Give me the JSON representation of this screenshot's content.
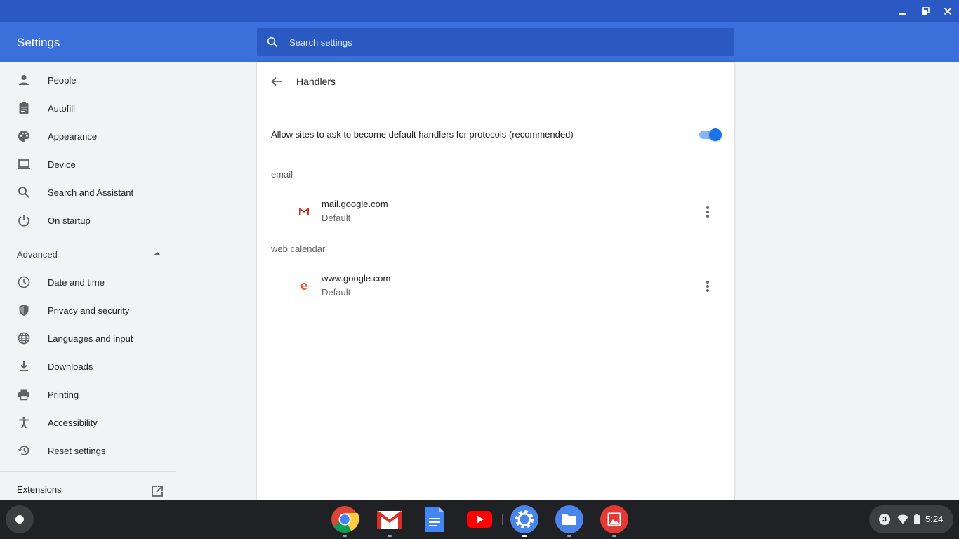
{
  "app": {
    "title": "Settings"
  },
  "search": {
    "placeholder": "Search settings"
  },
  "sidebar": {
    "items": [
      {
        "label": "People",
        "icon": "person-icon"
      },
      {
        "label": "Autofill",
        "icon": "clipboard-icon"
      },
      {
        "label": "Appearance",
        "icon": "palette-icon"
      },
      {
        "label": "Device",
        "icon": "laptop-icon"
      },
      {
        "label": "Search and Assistant",
        "icon": "search-icon"
      },
      {
        "label": "On startup",
        "icon": "power-icon"
      }
    ],
    "advanced_label": "Advanced",
    "advanced_items": [
      {
        "label": "Date and time",
        "icon": "clock-icon"
      },
      {
        "label": "Privacy and security",
        "icon": "shield-icon"
      },
      {
        "label": "Languages and input",
        "icon": "globe-icon"
      },
      {
        "label": "Downloads",
        "icon": "download-icon"
      },
      {
        "label": "Printing",
        "icon": "printer-icon"
      },
      {
        "label": "Accessibility",
        "icon": "accessibility-icon"
      },
      {
        "label": "Reset settings",
        "icon": "history-icon"
      }
    ],
    "extensions_label": "Extensions"
  },
  "page": {
    "title": "Handlers",
    "toggle_label": "Allow sites to ask to become default handlers for protocols (recommended)",
    "toggle_on": true,
    "sections": [
      {
        "label": "email",
        "handler": {
          "host": "mail.google.com",
          "status": "Default",
          "icon": "gmail-icon"
        }
      },
      {
        "label": "web calendar",
        "handler": {
          "host": "www.google.com",
          "status": "Default",
          "icon": "calendar-e-icon"
        }
      }
    ]
  },
  "shelf": {
    "apps": [
      "chrome-icon",
      "gmail-icon",
      "docs-icon",
      "youtube-icon",
      "settings-icon",
      "files-icon",
      "gallery-icon"
    ],
    "notification_count": "3",
    "time": "5:24"
  },
  "colors": {
    "titlebar": "#2b59c3",
    "header": "#3b6fd9",
    "accent": "#1a73e8"
  }
}
